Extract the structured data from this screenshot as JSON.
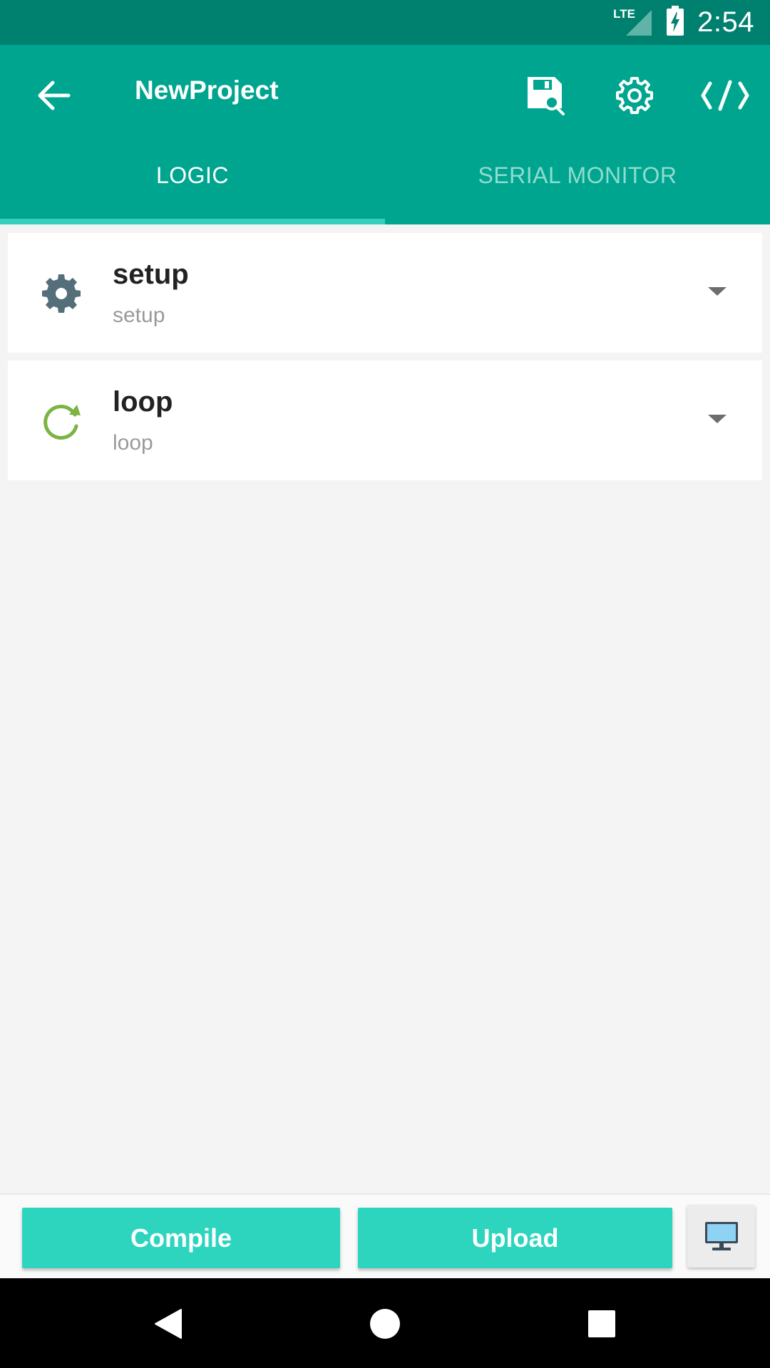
{
  "status_bar": {
    "network": "LTE",
    "time": "2:54"
  },
  "app_bar": {
    "title": "NewProject",
    "icons": [
      "back-arrow-icon",
      "save-search-icon",
      "gear-icon",
      "code-icon"
    ]
  },
  "tabs": [
    {
      "label": "LOGIC",
      "active": true
    },
    {
      "label": "SERIAL MONITOR",
      "active": false
    }
  ],
  "functions": [
    {
      "name": "setup",
      "subtitle": "setup",
      "icon": "gear-icon",
      "icon_color": "#546e7a"
    },
    {
      "name": "loop",
      "subtitle": "loop",
      "icon": "loop-icon",
      "icon_color": "#7cb342"
    }
  ],
  "bottom_bar": {
    "compile_label": "Compile",
    "upload_label": "Upload",
    "monitor_icon": "monitor-icon"
  },
  "colors": {
    "status_bar": "#00806f",
    "primary": "#00a58f",
    "accent": "#2dd5bf"
  }
}
